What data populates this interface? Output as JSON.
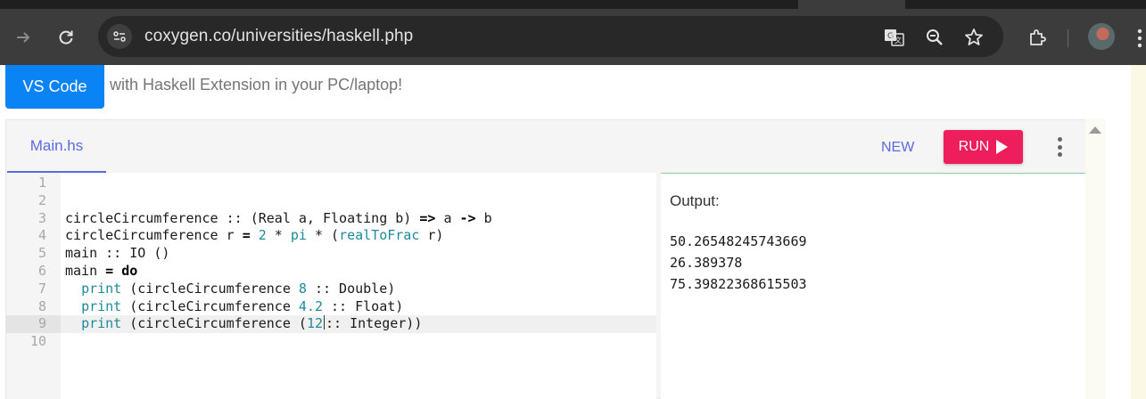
{
  "browser": {
    "url": "coxygen.co/universities/haskell.php",
    "icons": [
      "forward-icon",
      "reload-icon",
      "site-info-icon",
      "translate-icon",
      "zoom-icon",
      "bookmark-star-icon",
      "extensions-icon",
      "profile-avatar",
      "menu-icon"
    ]
  },
  "page": {
    "vscode_button": "VS Code",
    "promo_text": "with Haskell Extension in your PC/laptop!"
  },
  "editor": {
    "tab_label": "Main.hs",
    "new_label": "NEW",
    "run_label": "RUN",
    "line_numbers": [
      "1",
      "2",
      "3",
      "4",
      "5",
      "6",
      "7",
      "8",
      "9",
      "10"
    ],
    "active_line": 9
  },
  "output": {
    "title": "Output:",
    "lines": [
      "50.26548245743669",
      "26.389378",
      "75.39822368615503"
    ]
  },
  "colors": {
    "run_button": "#ee1d5c",
    "accent": "#5b6be0",
    "vscode_button": "#0a84f5"
  }
}
